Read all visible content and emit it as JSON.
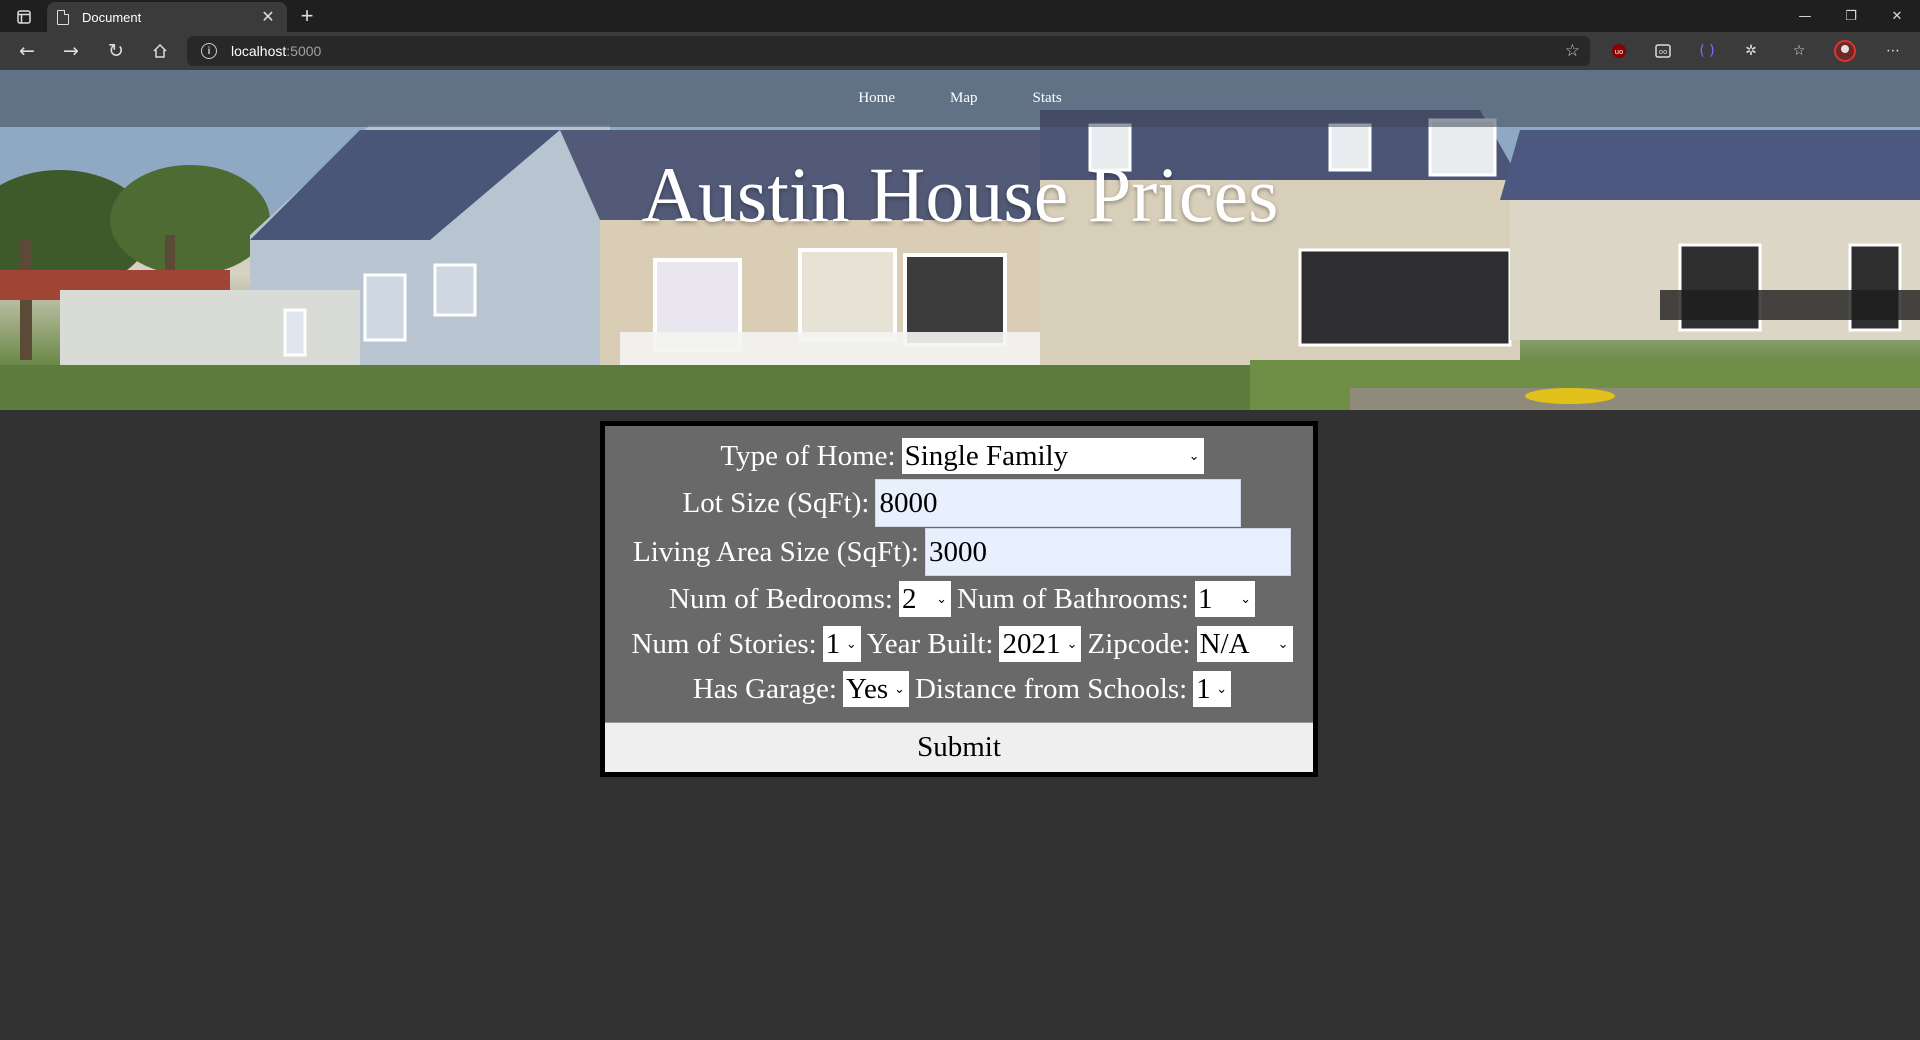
{
  "browser": {
    "tab_title": "Document",
    "url_host": "localhost",
    "url_port": ":5000"
  },
  "nav": {
    "items": [
      {
        "label": "Home"
      },
      {
        "label": "Map"
      },
      {
        "label": "Stats"
      }
    ]
  },
  "hero": {
    "title": "Austin House Prices"
  },
  "form": {
    "home_type": {
      "label": "Type of Home:",
      "value": "Single Family"
    },
    "lot_size": {
      "label": "Lot Size (SqFt):",
      "value": "8000"
    },
    "living_area": {
      "label": "Living Area Size (SqFt):",
      "value": "3000"
    },
    "bedrooms": {
      "label": "Num of Bedrooms:",
      "value": "2"
    },
    "bathrooms": {
      "label": "Num of Bathrooms:",
      "value": "1"
    },
    "stories": {
      "label": "Num of Stories:",
      "value": "1"
    },
    "year_built": {
      "label": "Year Built:",
      "value": "2021"
    },
    "zipcode": {
      "label": "Zipcode:",
      "value": "N/A"
    },
    "garage": {
      "label": "Has Garage:",
      "value": "Yes"
    },
    "schools_distance": {
      "label": "Distance from Schools:",
      "value": "1"
    },
    "submit_label": "Submit"
  }
}
